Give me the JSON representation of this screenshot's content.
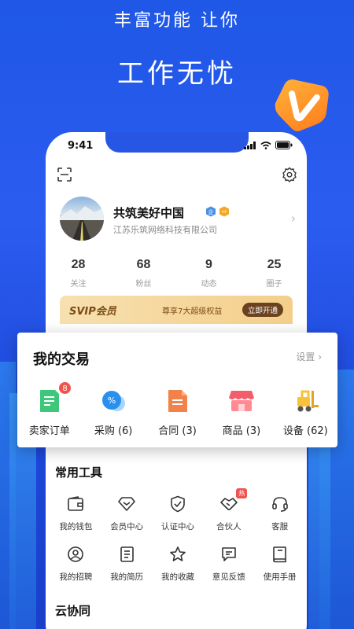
{
  "promo": {
    "headline_small": "丰富功能 让你",
    "headline_large": "工作无忧"
  },
  "status_bar": {
    "time": "9:41"
  },
  "profile": {
    "name": "共筑美好中国",
    "company": "江苏乐筑网络科技有限公司",
    "badge_enterprise": "企",
    "badge_vip": "VIP"
  },
  "stats": [
    {
      "value": "28",
      "label": "关注"
    },
    {
      "value": "68",
      "label": "粉丝"
    },
    {
      "value": "9",
      "label": "动态"
    },
    {
      "value": "25",
      "label": "圈子"
    }
  ],
  "svip": {
    "logo": "SVIP会员",
    "description": "尊享7大超级权益",
    "button": "立即开通"
  },
  "trade": {
    "title": "我的交易",
    "settings": "设置",
    "items": [
      {
        "label": "卖家订单",
        "icon": "order-icon",
        "badge": "8"
      },
      {
        "label": "采购 (6)",
        "icon": "purchase-icon"
      },
      {
        "label": "合同 (3)",
        "icon": "contract-icon"
      },
      {
        "label": "商品 (3)",
        "icon": "shop-icon"
      },
      {
        "label": "设备 (62)",
        "icon": "forklift-icon"
      }
    ]
  },
  "tools": {
    "title": "常用工具",
    "items": [
      {
        "label": "我的钱包",
        "icon": "wallet-icon"
      },
      {
        "label": "会员中心",
        "icon": "diamond-icon"
      },
      {
        "label": "认证中心",
        "icon": "shield-check-icon"
      },
      {
        "label": "合伙人",
        "icon": "handshake-icon",
        "tag": "热"
      },
      {
        "label": "客服",
        "icon": "headset-icon"
      },
      {
        "label": "我的招聘",
        "icon": "recruit-icon"
      },
      {
        "label": "我的简历",
        "icon": "resume-icon"
      },
      {
        "label": "我的收藏",
        "icon": "star-icon"
      },
      {
        "label": "意见反馈",
        "icon": "feedback-icon"
      },
      {
        "label": "使用手册",
        "icon": "manual-icon"
      }
    ]
  },
  "cloud": {
    "title": "云协同"
  },
  "colors": {
    "brand_blue": "#2656e3",
    "badge_red": "#ef5350",
    "svip_gold": "#f4cf8b"
  }
}
